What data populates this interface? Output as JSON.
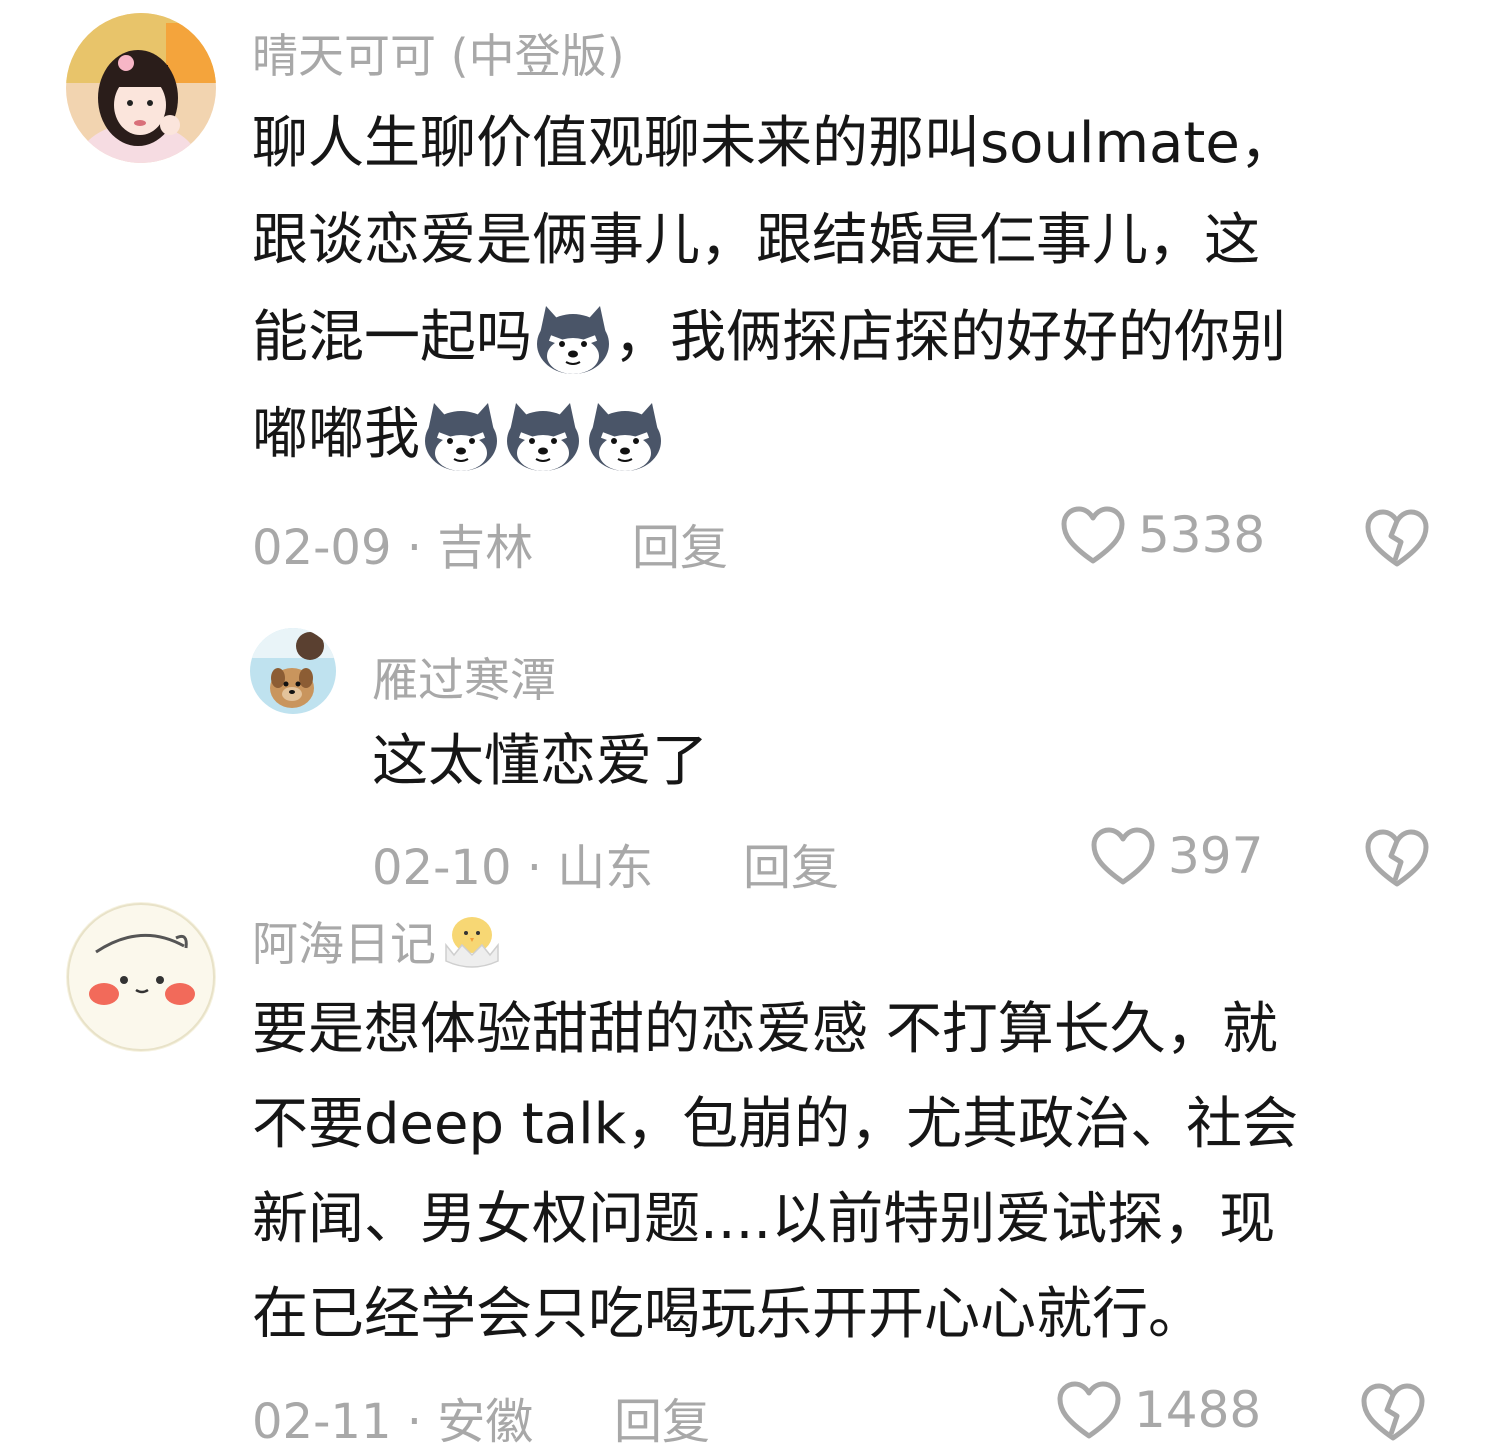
{
  "comments": [
    {
      "username": "晴天可可 (中登版)",
      "lines": [
        "聊人生聊价值观聊未来的那叫soulmate，",
        "跟谈恋爱是俩事儿，跟结婚是仨事儿，这",
        [
          "能混一起吗",
          "wolf-emoji",
          "，我俩探店探的好好的你别"
        ],
        [
          "嘟嘟我",
          "wolf-emoji",
          "wolf-emoji",
          "wolf-emoji"
        ]
      ],
      "date_location": "02-09 · 吉林",
      "reply_label": "回复",
      "likes": "5338"
    },
    {
      "username": "雁过寒潭",
      "lines": [
        "这太懂恋爱了"
      ],
      "date_location": "02-10 · 山东",
      "reply_label": "回复",
      "likes": "397"
    },
    {
      "username": "阿海日记",
      "username_icon": "chick-icon",
      "lines": [
        "要是想体验甜甜的恋爱感 不打算长久，就",
        "不要deep talk，包崩的，尤其政治、社会",
        "新闻、男女权问题....以前特别爱试探，现",
        "在已经学会只吃喝玩乐开开心心就行。"
      ],
      "date_location": "02-11 · 安徽",
      "reply_label": "回复",
      "likes": "1488"
    }
  ],
  "icons": {
    "like": "heart-outline-icon",
    "dislike": "broken-heart-icon"
  },
  "colors": {
    "text": "#161616",
    "meta": "#a8a8a8",
    "background": "#ffffff"
  }
}
